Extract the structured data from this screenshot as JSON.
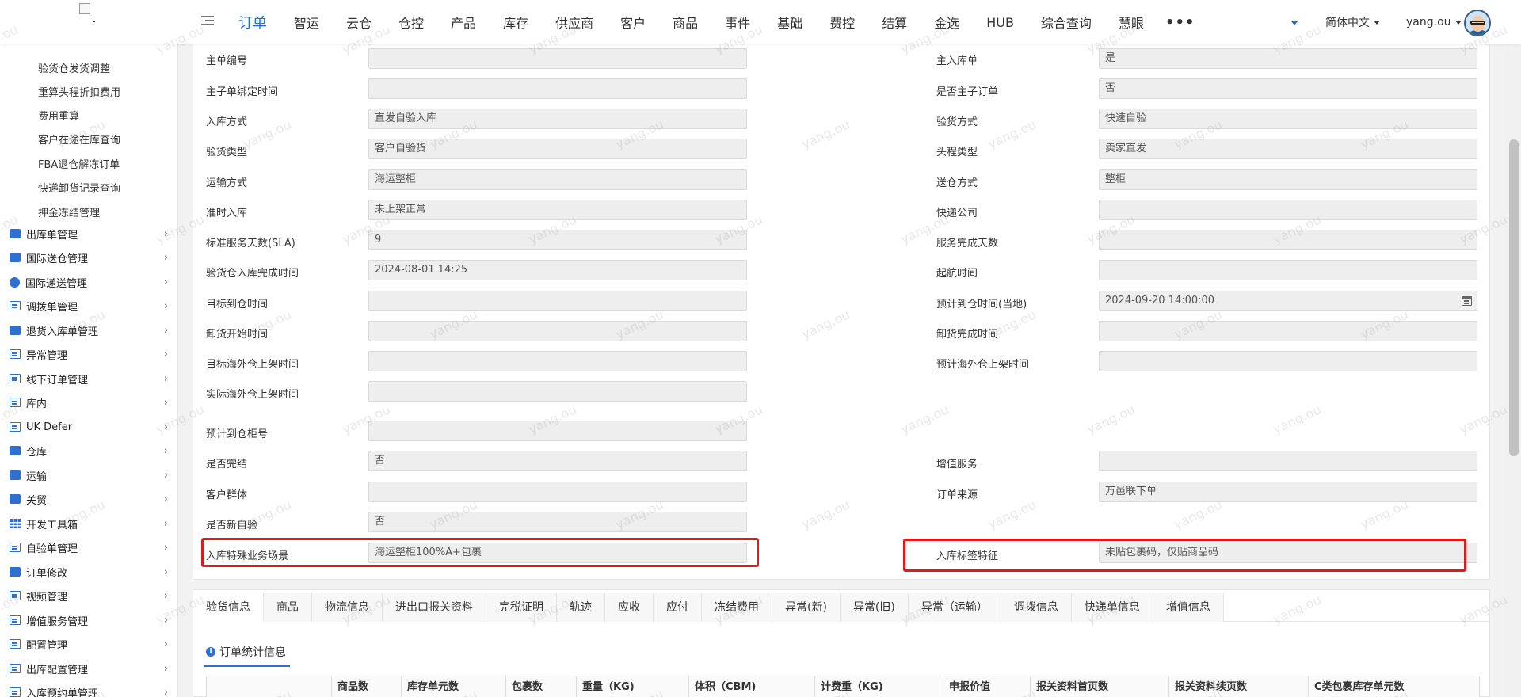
{
  "topnav": {
    "menu": [
      {
        "label": "订单",
        "active": true
      },
      {
        "label": "智运"
      },
      {
        "label": "云仓"
      },
      {
        "label": "仓控"
      },
      {
        "label": "产品"
      },
      {
        "label": "库存"
      },
      {
        "label": "供应商"
      },
      {
        "label": "客户"
      },
      {
        "label": "商品"
      },
      {
        "label": "事件"
      },
      {
        "label": "基础"
      },
      {
        "label": "费控"
      },
      {
        "label": "结算"
      },
      {
        "label": "金选"
      },
      {
        "label": "HUB"
      },
      {
        "label": "综合查询"
      },
      {
        "label": "慧眼"
      }
    ],
    "more_label": "•••",
    "language": "简体中文",
    "username": "yang.ou",
    "accent_color": "#1e6fd9"
  },
  "sidebar": {
    "sub_items": [
      "验货仓发货调整",
      "重算头程折扣费用",
      "费用重算",
      "客户在途在库查询",
      "FBA退仓解冻订单",
      "快递卸货记录查询",
      "押金冻结管理"
    ],
    "items": [
      {
        "label": "出库单管理",
        "icon": "export-icon"
      },
      {
        "label": "国际送仓管理",
        "icon": "briefcase-icon"
      },
      {
        "label": "国际递送管理",
        "icon": "globe-icon"
      },
      {
        "label": "调拨单管理",
        "icon": "document-icon"
      },
      {
        "label": "退货入库单管理",
        "icon": "return-icon"
      },
      {
        "label": "异常管理",
        "icon": "warning-document-icon"
      },
      {
        "label": "线下订单管理",
        "icon": "list-icon"
      },
      {
        "label": "库内",
        "icon": "document-icon"
      },
      {
        "label": "UK Defer",
        "icon": "document-icon"
      },
      {
        "label": "仓库",
        "icon": "warehouse-icon"
      },
      {
        "label": "运输",
        "icon": "truck-icon"
      },
      {
        "label": "关贸",
        "icon": "customs-icon"
      },
      {
        "label": "开发工具箱",
        "icon": "grid-icon"
      },
      {
        "label": "自验单管理",
        "icon": "document-icon"
      },
      {
        "label": "订单修改",
        "icon": "edit-icon"
      },
      {
        "label": "视频管理",
        "icon": "list-icon"
      },
      {
        "label": "增值服务管理",
        "icon": "list-icon"
      },
      {
        "label": "配置管理",
        "icon": "list-icon"
      },
      {
        "label": "出库配置管理",
        "icon": "list-icon"
      },
      {
        "label": "入库预约单管理",
        "icon": "list-icon"
      }
    ]
  },
  "form": {
    "left": [
      {
        "label": "主单编号",
        "value": ""
      },
      {
        "label": "主子单绑定时间",
        "value": ""
      },
      {
        "label": "入库方式",
        "value": "直发自验入库"
      },
      {
        "label": "验货类型",
        "value": "客户自验货"
      },
      {
        "label": "运输方式",
        "value": "海运整柜"
      },
      {
        "label": "准时入库",
        "value": "未上架正常"
      },
      {
        "label": "标准服务天数(SLA)",
        "value": "9"
      },
      {
        "label": "验货仓入库完成时间",
        "value": "2024-08-01 14:25"
      },
      {
        "label": "目标到仓时间",
        "value": ""
      },
      {
        "label": "卸货开始时间",
        "value": ""
      },
      {
        "label": "目标海外仓上架时间",
        "value": ""
      },
      {
        "label": "实际海外仓上架时间",
        "value": ""
      },
      {
        "label": "预计到仓柜号",
        "value": ""
      },
      {
        "label": "是否完结",
        "value": "否"
      },
      {
        "label": "客户群体",
        "value": ""
      },
      {
        "label": "是否新自验",
        "value": "否"
      },
      {
        "label": "入库特殊业务场景",
        "value": "海运整柜100%A+包裹"
      }
    ],
    "right": [
      {
        "label": "主入库单",
        "value": "是"
      },
      {
        "label": "是否主子订单",
        "value": "否"
      },
      {
        "label": "验货方式",
        "value": "快速自验"
      },
      {
        "label": "头程类型",
        "value": "卖家直发"
      },
      {
        "label": "送仓方式",
        "value": "整柜"
      },
      {
        "label": "快递公司",
        "value": ""
      },
      {
        "label": "服务完成天数",
        "value": ""
      },
      {
        "label": "起航时间",
        "value": ""
      },
      {
        "label": "预计到仓时间(当地)",
        "value": "2024-09-20 14:00:00"
      },
      {
        "label": "卸货完成时间",
        "value": ""
      },
      {
        "label": "预计海外仓上架时间",
        "value": ""
      },
      {
        "label": "增值服务",
        "value": ""
      },
      {
        "label": "订单来源",
        "value": "万邑联下单"
      },
      {
        "label": "入库标签特征",
        "value": "未贴包裹码，仅贴商品码"
      }
    ],
    "highlight_color": "#e21919"
  },
  "tabs": [
    "验货信息",
    "商品",
    "物流信息",
    "进出口报关资料",
    "完税证明",
    "轨迹",
    "应收",
    "应付",
    "冻结费用",
    "异常(新)",
    "异常(旧)",
    "异常（运输）",
    "调拨信息",
    "快递单信息",
    "增值信息"
  ],
  "active_tab": "验货信息",
  "section": {
    "title": "订单统计信息",
    "columns": [
      "",
      "商品数",
      "库存单元数",
      "包裹数",
      "重量（KG)",
      "体积（CBM)",
      "计费重（KG)",
      "申报价值",
      "报关资料首页数",
      "报关资料续页数",
      "C类包裹库存单元数"
    ]
  },
  "watermark": "yang.ou"
}
